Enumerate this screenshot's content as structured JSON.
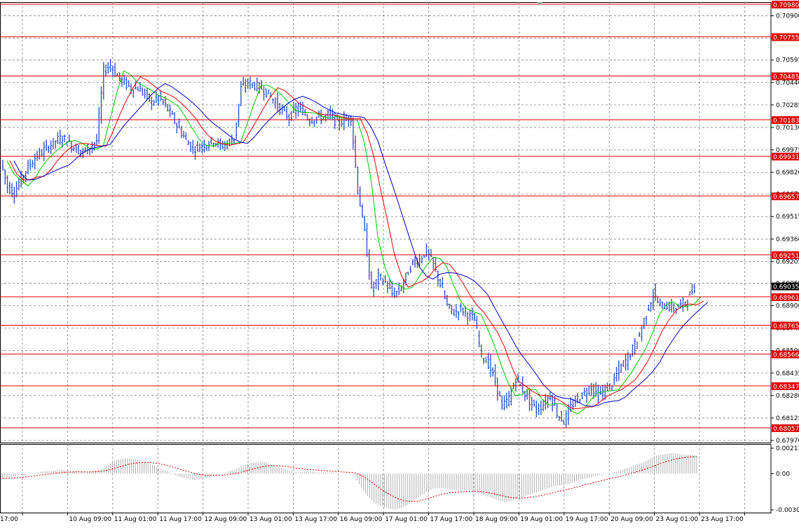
{
  "chart_data": {
    "type": "candlestick",
    "instrument_note": "",
    "y_axis": {
      "min": 0.6797,
      "max": 0.7098,
      "tick_labels": [
        "0.70900",
        "0.70745",
        "0.70595",
        "0.70440",
        "0.70285",
        "0.70130",
        "0.69975",
        "0.69820",
        "0.69670",
        "0.69515",
        "0.69360",
        "0.69205",
        "0.69055",
        "0.68900",
        "0.68745",
        "0.68590",
        "0.68435",
        "0.68280",
        "0.68125",
        "0.67970"
      ],
      "tick_values": [
        0.709,
        0.70745,
        0.70595,
        0.7044,
        0.70285,
        0.7013,
        0.69975,
        0.6982,
        0.6967,
        0.69515,
        0.6936,
        0.69205,
        0.69055,
        0.689,
        0.68745,
        0.6859,
        0.68435,
        0.6828,
        0.68125,
        0.6797
      ]
    },
    "x_axis": {
      "tick_labels": [
        "17:00",
        "10 Aug 09:00",
        "11 Aug 01:00",
        "11 Aug 17:00",
        "12 Aug 09:00",
        "13 Aug 01:00",
        "13 Aug 17:00",
        "16 Aug 09:00",
        "17 Aug 01:00",
        "17 Aug 17:00",
        "18 Aug 09:00",
        "19 Aug 01:00",
        "19 Aug 17:00",
        "20 Aug 09:00",
        "23 Aug 01:00",
        "23 Aug 17:00"
      ]
    },
    "levels": [
      {
        "label": "0.70980",
        "value": 0.7098
      },
      {
        "label": "0.70755",
        "value": 0.70755
      },
      {
        "label": "0.70485",
        "value": 0.70485
      },
      {
        "label": "0.70183",
        "value": 0.70183
      },
      {
        "label": "0.69931",
        "value": 0.69931
      },
      {
        "label": "0.69657",
        "value": 0.69657
      },
      {
        "label": "0.69251",
        "value": 0.69251
      },
      {
        "label": "0.68961",
        "value": 0.68961
      },
      {
        "label": "0.68765",
        "value": 0.68765
      },
      {
        "label": "0.68566",
        "value": 0.68566
      },
      {
        "label": "0.68347",
        "value": 0.68347
      },
      {
        "label": "0.68057",
        "value": 0.68057
      }
    ],
    "current_price": {
      "label": "0.69035",
      "value": 0.69035
    },
    "price_path": [
      0.699,
      0.6972,
      0.6968,
      0.6978,
      0.6986,
      0.6992,
      0.6996,
      0.7,
      0.7004,
      0.7006,
      0.7002,
      0.6998,
      0.6996,
      0.7,
      0.7004,
      0.7052,
      0.7056,
      0.7048,
      0.7044,
      0.704,
      0.704,
      0.7036,
      0.703,
      0.7034,
      0.7028,
      0.702,
      0.7012,
      0.7004,
      0.6998,
      0.7,
      0.7002,
      0.7004,
      0.7,
      0.7002,
      0.7006,
      0.704,
      0.7044,
      0.7042,
      0.704,
      0.7036,
      0.703,
      0.7024,
      0.702,
      0.7026,
      0.7024,
      0.7018,
      0.702,
      0.702,
      0.7022,
      0.7016,
      0.7018,
      0.702,
      0.697,
      0.694,
      0.69,
      0.691,
      0.6906,
      0.6898,
      0.69,
      0.691,
      0.692,
      0.6922,
      0.6928,
      0.6918,
      0.6905,
      0.689,
      0.6885,
      0.6888,
      0.6884,
      0.688,
      0.6856,
      0.685,
      0.6838,
      0.682,
      0.6826,
      0.684,
      0.6832,
      0.6824,
      0.6818,
      0.6822,
      0.6828,
      0.6816,
      0.681,
      0.682,
      0.6826,
      0.683,
      0.6834,
      0.6828,
      0.6832,
      0.6836,
      0.6846,
      0.6852,
      0.686,
      0.687,
      0.6885,
      0.6898,
      0.689,
      0.689,
      0.6888,
      0.689,
      0.6895,
      0.6903
    ],
    "macd": {
      "tick_labels": [
        "0.00213",
        "0.00",
        "-0.00302"
      ],
      "tick_values": [
        0.00213,
        0.0,
        -0.00302
      ],
      "hist_path": [
        -0.0004,
        -0.0003,
        -0.0002,
        -0.0001,
        0.0,
        0.0001,
        0.0002,
        0.0002,
        0.0003,
        0.0003,
        0.0002,
        0.0002,
        0.0001,
        0.0002,
        0.0003,
        0.0006,
        0.001,
        0.0012,
        0.0013,
        0.0012,
        0.0011,
        0.0009,
        0.0007,
        0.0004,
        0.0002,
        -0.0001,
        -0.0003,
        -0.0004,
        -0.0005,
        -0.0004,
        -0.0003,
        -0.0001,
        0.0,
        0.0002,
        0.0004,
        0.0007,
        0.0009,
        0.001,
        0.001,
        0.0008,
        0.0006,
        0.0004,
        0.0002,
        0.0001,
        0.0002,
        0.0002,
        0.0001,
        0.0001,
        0.0001,
        0.0,
        0.0,
        0.0,
        -0.001,
        -0.0018,
        -0.0024,
        -0.0027,
        -0.0029,
        -0.003,
        -0.0029,
        -0.0026,
        -0.0022,
        -0.0018,
        -0.0014,
        -0.0012,
        -0.0012,
        -0.0013,
        -0.0014,
        -0.0014,
        -0.0014,
        -0.0015,
        -0.0018,
        -0.002,
        -0.0022,
        -0.0024,
        -0.0023,
        -0.0021,
        -0.0019,
        -0.0017,
        -0.0015,
        -0.0013,
        -0.0011,
        -0.001,
        -0.0009,
        -0.0007,
        -0.0005,
        -0.0004,
        -0.0002,
        -0.0001,
        0.0,
        0.0001,
        0.0003,
        0.0005,
        0.0007,
        0.0009,
        0.0012,
        0.0015,
        0.0016,
        0.0017,
        0.0017,
        0.0016,
        0.0016,
        0.0015
      ]
    },
    "moving_averages": [
      {
        "color": "#00cc00",
        "period_hint": "fast"
      },
      {
        "color": "#ff0000",
        "period_hint": "medium"
      },
      {
        "color": "#0000cc",
        "period_hint": "slow"
      }
    ]
  },
  "colors": {
    "background": "#ffffff",
    "grid": "#808080",
    "candles": "#3355cc",
    "level_line": "#e00000",
    "level_box": "#e00000",
    "current_box": "#000000",
    "macd_hist": "#b0b0b0",
    "macd_signal": "#e00000"
  }
}
